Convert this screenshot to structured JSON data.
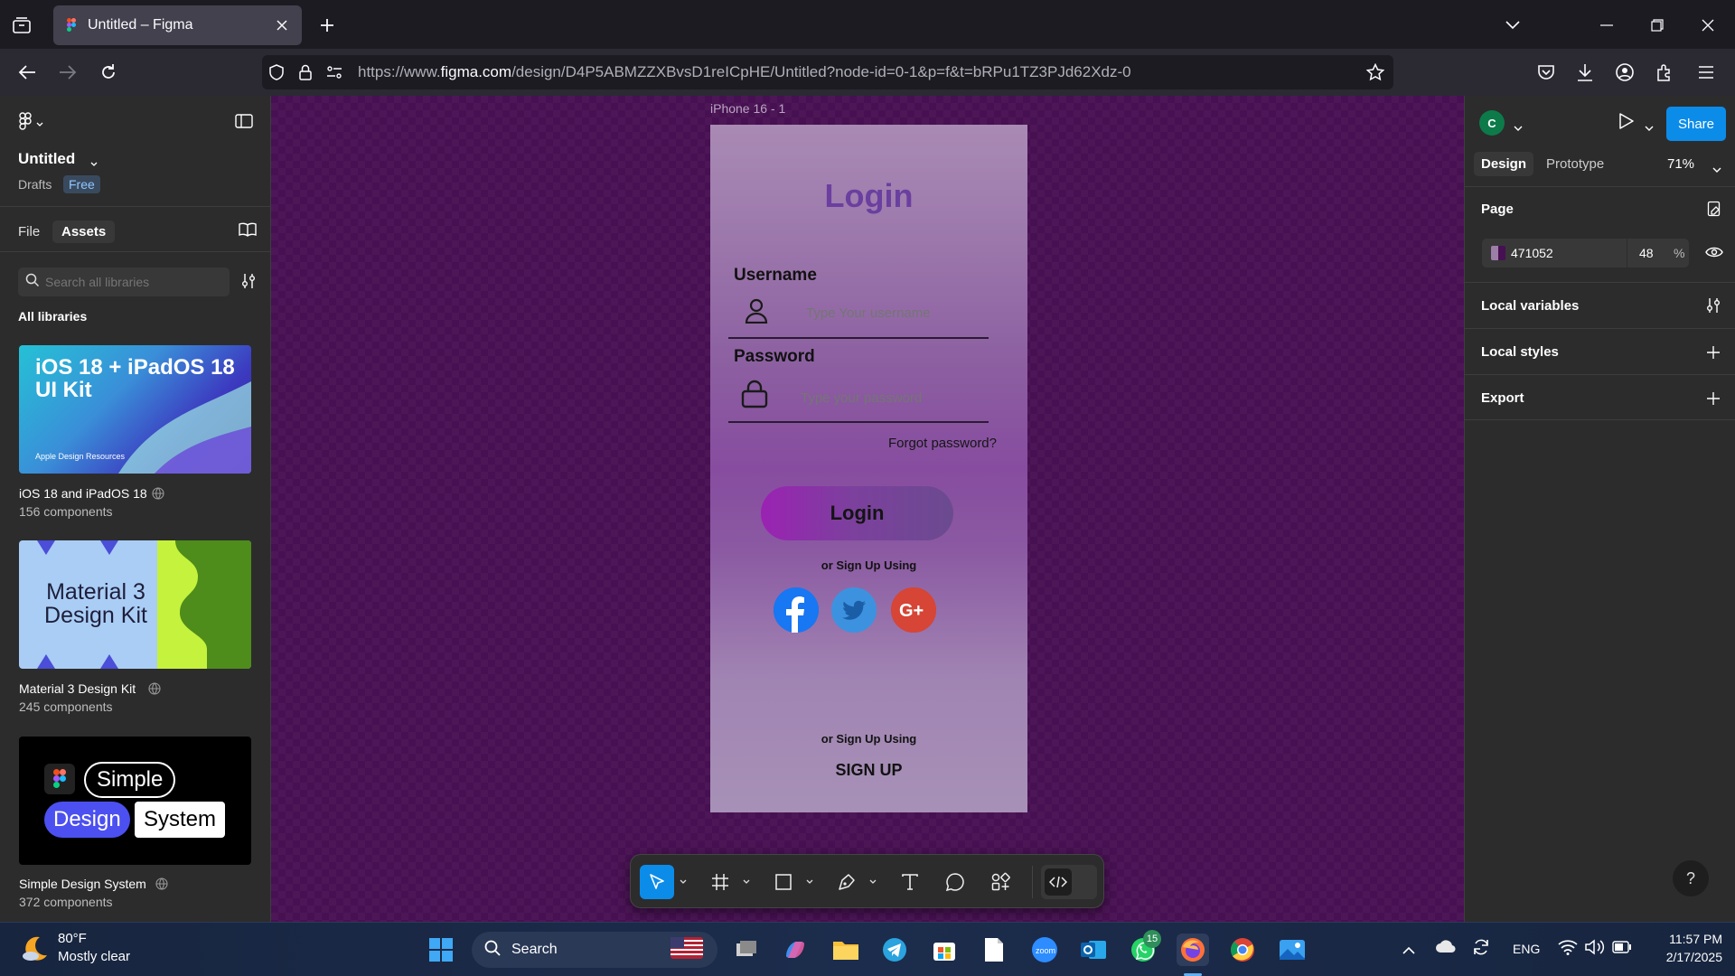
{
  "browser": {
    "tab_title": "Untitled – Figma",
    "url_prefix": "https://www.",
    "url_domain": "figma.com",
    "url_path": "/design/D4P5ABMZZXBvsD1reICpHE/Untitled?node-id=0-1&p=f&t=bRPu1TZ3PJd62Xdz-0"
  },
  "left_panel": {
    "file_name": "Untitled",
    "drafts_label": "Drafts",
    "plan_badge": "Free",
    "tabs": {
      "file": "File",
      "assets": "Assets"
    },
    "search_placeholder": "Search all libraries",
    "all_libraries_label": "All libraries",
    "libraries": [
      {
        "name": "iOS 18 and iPadOS 18",
        "count": "156 components",
        "thumb_title": "iOS 18 + iPadOS 18 UI Kit",
        "thumb_caption": "Apple Design Resources"
      },
      {
        "name": "Material 3 Design Kit",
        "count": "245 components",
        "thumb_title": "Material 3 Design Kit"
      },
      {
        "name": "Simple Design System",
        "count": "372 components",
        "thumb_words": [
          "Simple",
          "Design",
          "System"
        ]
      }
    ]
  },
  "canvas": {
    "frame_label": "iPhone 16 - 1",
    "background_color": "#471052",
    "login_title": "Login",
    "username_label": "Username",
    "username_placeholder": "Type Your username",
    "password_label": "Password",
    "password_placeholder": "Type your password",
    "forgot_password": "Forgot password?",
    "login_button": "Login",
    "or_signup_1": "or Sign Up Using",
    "or_signup_2": "or Sign Up Using",
    "signup_link": "SIGN UP",
    "social": [
      "facebook",
      "twitter",
      "google-plus"
    ]
  },
  "toolbar": {
    "tools": [
      "move-tool",
      "frame-tool",
      "shape-tool",
      "pen-tool",
      "text-tool",
      "comment-tool",
      "actions-tool",
      "dev-mode-toggle"
    ]
  },
  "right_panel": {
    "avatar_initial": "C",
    "share_label": "Share",
    "tabs": {
      "design": "Design",
      "prototype": "Prototype"
    },
    "zoom": "71%",
    "page_section": "Page",
    "page_color_hex": "471052",
    "page_opacity": "48",
    "percent_sign": "%",
    "local_variables": "Local variables",
    "local_styles": "Local styles",
    "export": "Export",
    "help": "?"
  },
  "taskbar": {
    "weather_temp": "80°F",
    "weather_desc": "Mostly clear",
    "search_label": "Search",
    "whatsapp_badge": "15",
    "language": "ENG",
    "time": "11:57 PM",
    "date": "2/17/2025"
  },
  "colors": {
    "accent_blue": "#0c8ce9",
    "canvas_bg": "#471052",
    "login_title": "#6a3fa0"
  }
}
